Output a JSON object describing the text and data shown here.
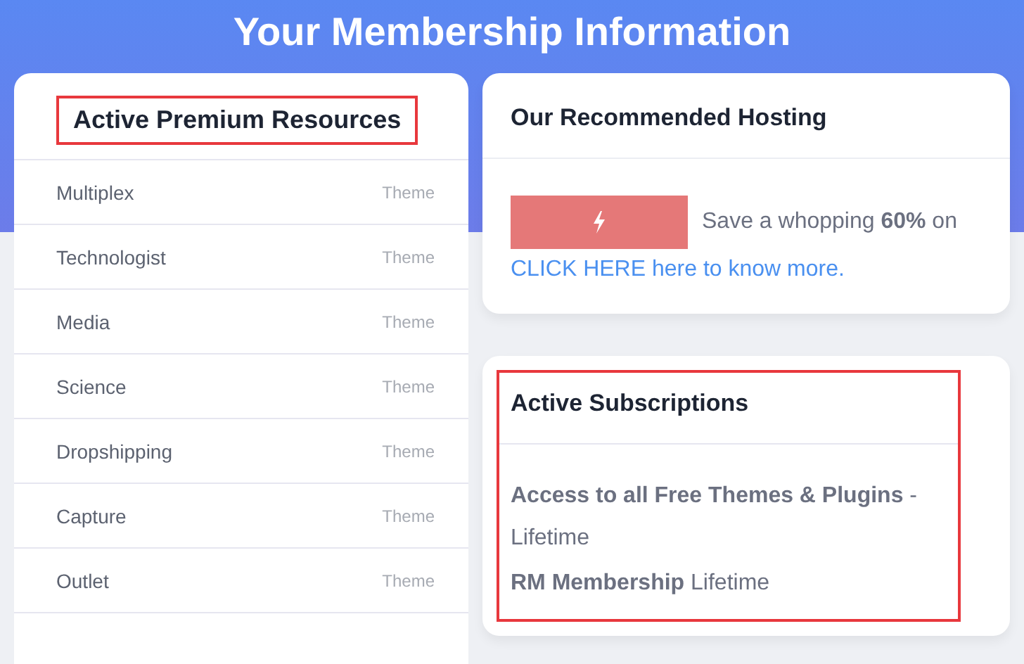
{
  "title": "Your Membership Information",
  "resources": {
    "heading": "Active Premium Resources",
    "highlighted": true,
    "items": [
      {
        "name": "Multiplex",
        "type": "Theme"
      },
      {
        "name": "Technologist",
        "type": "Theme"
      },
      {
        "name": "Media",
        "type": "Theme"
      },
      {
        "name": "Science",
        "type": "Theme"
      },
      {
        "name": "Dropshipping",
        "type": "Theme"
      },
      {
        "name": "Capture",
        "type": "Theme"
      },
      {
        "name": "Outlet",
        "type": "Theme"
      }
    ]
  },
  "hosting": {
    "heading": "Our Recommended Hosting",
    "offer": "Save a whopping **60%** on",
    "link": "CLICK HERE here to know more."
  },
  "subscriptions": {
    "heading": "Active Subscriptions",
    "highlighted": true,
    "lines": [
      "**Access to all Free Themes & Plugins** - Lifetime",
      "**RM Membership** Lifetime"
    ]
  }
}
